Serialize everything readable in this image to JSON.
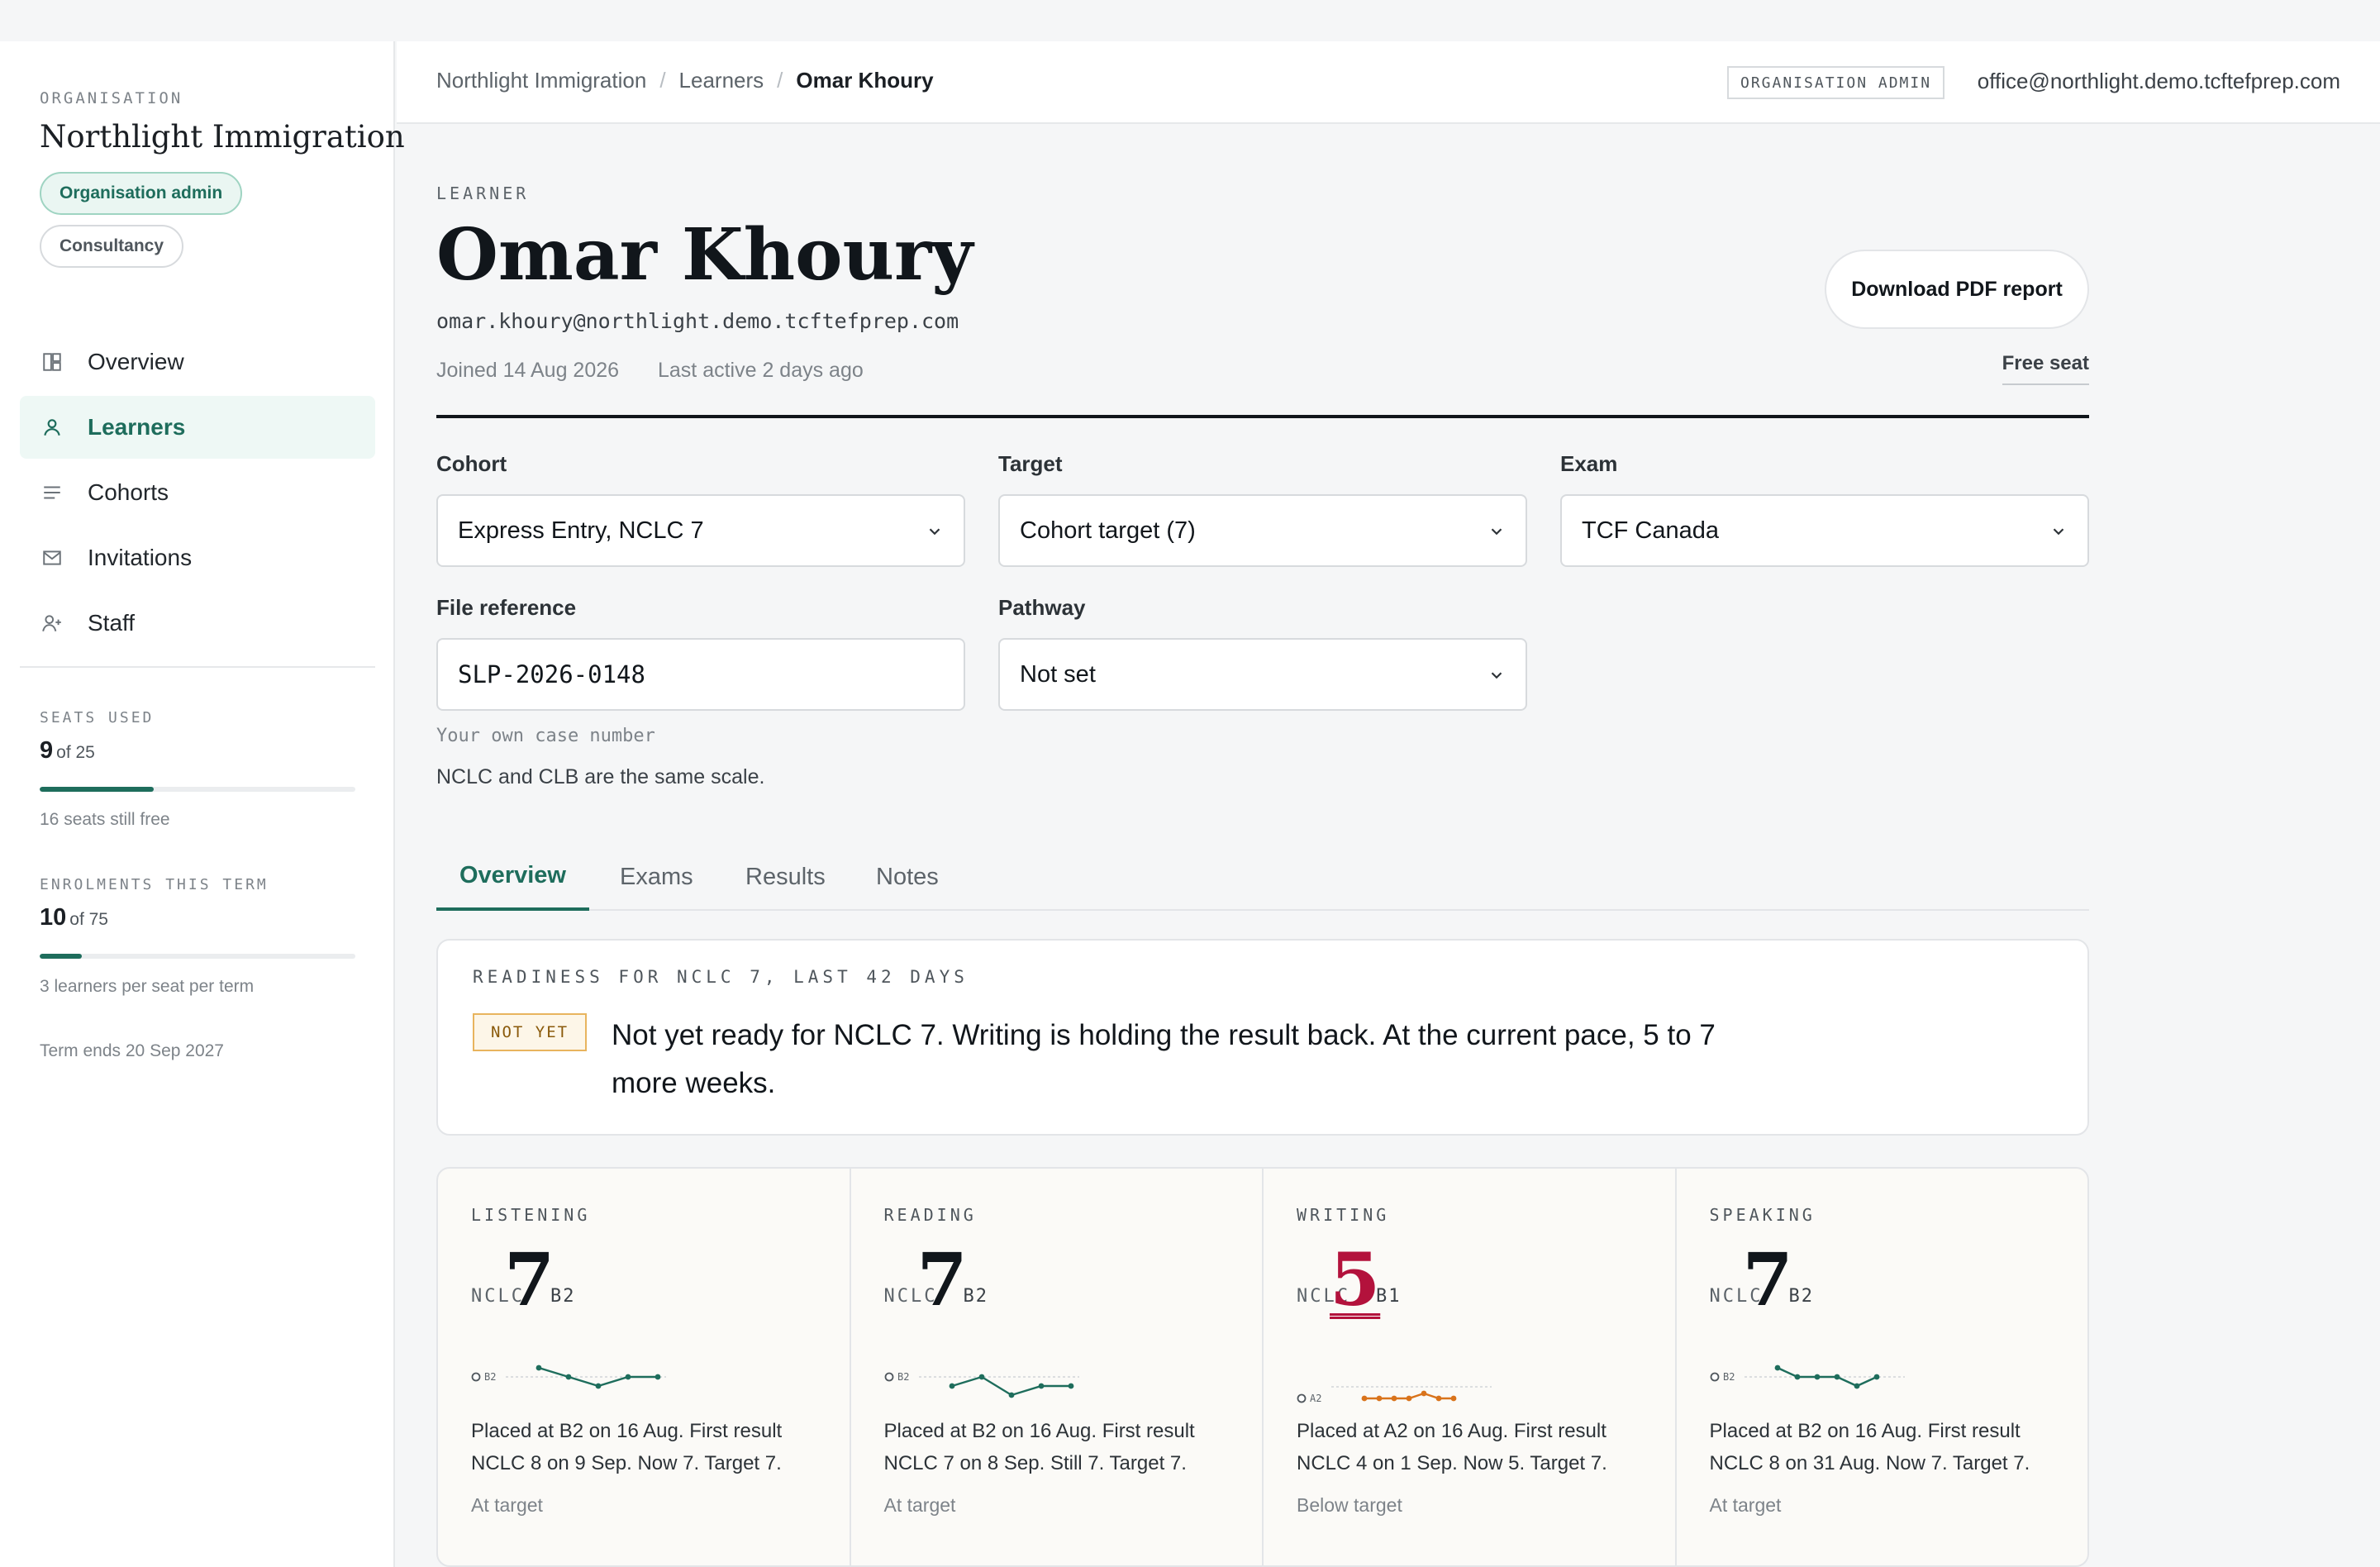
{
  "sidebar": {
    "org_caption": "ORGANISATION",
    "org_name": "Northlight Immigration",
    "role_pill": "Organisation admin",
    "type_pill": "Consultancy",
    "nav": [
      {
        "label": "Overview",
        "icon": "dashboard-icon",
        "active": false
      },
      {
        "label": "Learners",
        "icon": "user-icon",
        "active": true
      },
      {
        "label": "Cohorts",
        "icon": "list-icon",
        "active": false
      },
      {
        "label": "Invitations",
        "icon": "mail-icon",
        "active": false
      },
      {
        "label": "Staff",
        "icon": "user-plus-icon",
        "active": false
      }
    ],
    "seats": {
      "caption": "SEATS USED",
      "used": "9",
      "of": "of 25",
      "fraction": 0.36,
      "note": "16 seats still free"
    },
    "enrolments": {
      "caption": "ENROLMENTS THIS TERM",
      "used": "10",
      "of": "of 75",
      "fraction": 0.133,
      "note": "3 learners per seat per term"
    },
    "term_note": "Term ends 20 Sep 2027"
  },
  "topbar": {
    "breadcrumb": [
      "Northlight Immigration",
      "Learners",
      "Omar Khoury"
    ],
    "role_tag": "ORGANISATION ADMIN",
    "email": "office@northlight.demo.tcftefprep.com"
  },
  "learner": {
    "caption": "LEARNER",
    "name": "Omar Khoury",
    "email": "omar.khoury@northlight.demo.tcftefprep.com",
    "joined": "Joined 14 Aug 2026",
    "last_active": "Last active 2 days ago",
    "pdf_button": "Download PDF report",
    "seat_link": "Free seat"
  },
  "form": {
    "cohort": {
      "label": "Cohort",
      "value": "Express Entry, NCLC 7"
    },
    "target": {
      "label": "Target",
      "value": "Cohort target (7)"
    },
    "exam": {
      "label": "Exam",
      "value": "TCF Canada"
    },
    "file_ref": {
      "label": "File reference",
      "value": "SLP-2026-0148",
      "hint": "Your own case number"
    },
    "pathway": {
      "label": "Pathway",
      "value": "Not set"
    },
    "scale_note": "NCLC and CLB are the same scale."
  },
  "tabs": [
    "Overview",
    "Exams",
    "Results",
    "Notes"
  ],
  "readiness": {
    "caption": "READINESS FOR NCLC 7, LAST 42 DAYS",
    "badge": "NOT YET",
    "text": "Not yet ready for NCLC 7. Writing is holding the result back. At the current pace, 5 to 7 more weeks."
  },
  "skills": [
    {
      "caption": "LISTENING",
      "nclc_label": "NCLC",
      "score": "7",
      "cefr": "B2",
      "baseline_label": "B2",
      "low": false,
      "trend": [
        8,
        7.5,
        7,
        7.5,
        7.5
      ],
      "desc": "Placed at B2 on 16 Aug. First result NCLC 8 on 9 Sep. Now 7. Target 7.",
      "status": "At target"
    },
    {
      "caption": "READING",
      "nclc_label": "NCLC",
      "score": "7",
      "cefr": "B2",
      "baseline_label": "B2",
      "low": false,
      "trend": [
        7,
        7.5,
        6.5,
        7,
        7
      ],
      "desc": "Placed at B2 on 16 Aug. First result NCLC 7 on 8 Sep. Still 7. Target 7.",
      "status": "At target"
    },
    {
      "caption": "WRITING",
      "nclc_label": "NCLC",
      "score": "5",
      "cefr": "B1",
      "baseline_label": "A2",
      "low": true,
      "trend": [
        4,
        4,
        4,
        4,
        4.5,
        4,
        4
      ],
      "desc": "Placed at A2 on 16 Aug. First result NCLC 4 on 1 Sep. Now 5. Target 7.",
      "status": "Below target"
    },
    {
      "caption": "SPEAKING",
      "nclc_label": "NCLC",
      "score": "7",
      "cefr": "B2",
      "baseline_label": "B2",
      "low": false,
      "trend": [
        8,
        7.5,
        7.5,
        7.5,
        7,
        7.5
      ],
      "desc": "Placed at B2 on 16 Aug. First result NCLC 8 on 31 Aug. Now 7. Target 7.",
      "status": "At target"
    }
  ],
  "colors": {
    "accent": "#1e6d5c",
    "danger": "#b3123c",
    "warning": "#d9731b"
  }
}
